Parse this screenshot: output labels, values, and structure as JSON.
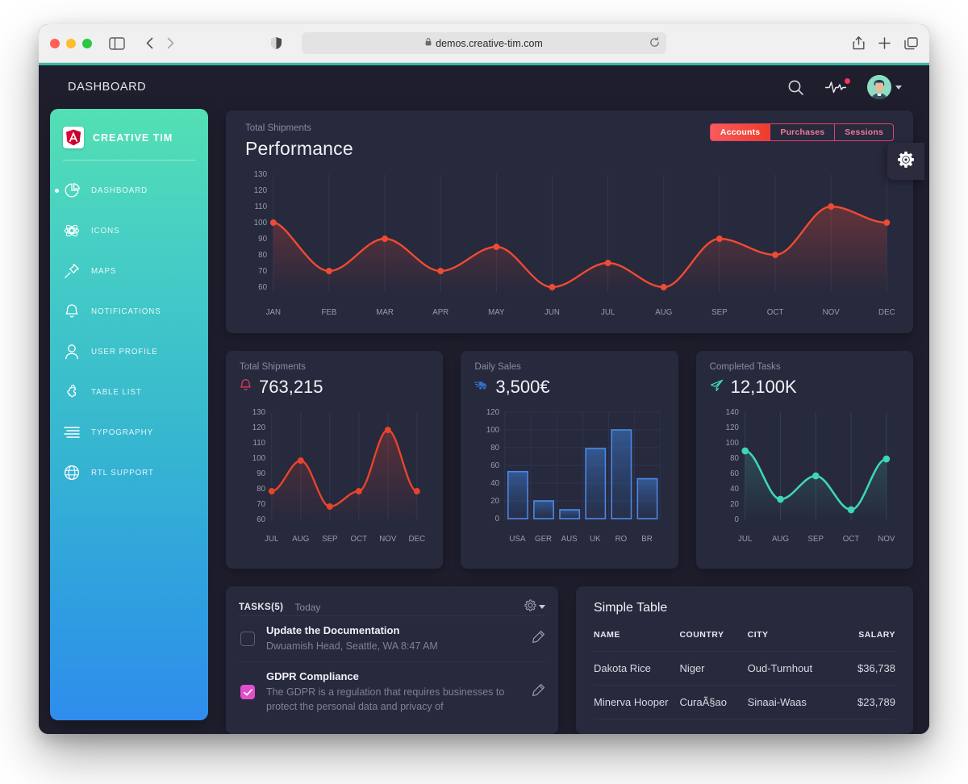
{
  "browser": {
    "url": "demos.creative-tim.com",
    "lock_icon": "lock-icon",
    "reload_icon": "reload-icon",
    "back_icon": "back-arrow-icon",
    "forward_icon": "forward-arrow-icon",
    "sidebar_icon": "sidebar-toggle-icon",
    "shield_icon": "shield-icon",
    "share_icon": "share-icon",
    "newtab_icon": "plus-icon",
    "tabs_icon": "tab-overview-icon"
  },
  "topbar": {
    "title": "DASHBOARD",
    "search_icon": "search-icon",
    "activity_icon": "activity-pulse-icon",
    "avatar": "user-avatar"
  },
  "sidebar": {
    "brand": "CREATIVE TIM",
    "brand_logo": "angular-logo-icon",
    "items": [
      {
        "label": "DASHBOARD",
        "icon": "pie-chart-icon",
        "active": true
      },
      {
        "label": "ICONS",
        "icon": "atom-icon",
        "active": false
      },
      {
        "label": "MAPS",
        "icon": "pin-icon",
        "active": false
      },
      {
        "label": "NOTIFICATIONS",
        "icon": "bell-icon",
        "active": false
      },
      {
        "label": "USER PROFILE",
        "icon": "user-icon",
        "active": false
      },
      {
        "label": "TABLE LIST",
        "icon": "puzzle-icon",
        "active": false
      },
      {
        "label": "TYPOGRAPHY",
        "icon": "text-align-icon",
        "active": false
      },
      {
        "label": "RTL SUPPORT",
        "icon": "globe-icon",
        "active": false
      }
    ]
  },
  "performance": {
    "subtitle": "Total Shipments",
    "title": "Performance",
    "tabs": [
      {
        "label": "Accounts",
        "active": true
      },
      {
        "label": "Purchases",
        "active": false
      },
      {
        "label": "Sessions",
        "active": false
      }
    ],
    "settings_icon": "gear-icon"
  },
  "cards": {
    "shipments": {
      "subtitle": "Total Shipments",
      "value": "763,215",
      "icon": "bell-icon",
      "color": "#f5365c"
    },
    "sales": {
      "subtitle": "Daily Sales",
      "value": "3,500€",
      "icon": "shipping-truck-icon",
      "color": "#2f74d0"
    },
    "tasks": {
      "subtitle": "Completed Tasks",
      "value": "12,100K",
      "icon": "send-plane-icon",
      "color": "#3ed6b5"
    }
  },
  "tasks_panel": {
    "title": "TASKS(5)",
    "today": "Today",
    "gear_icon": "gear-icon",
    "caret_icon": "chevron-down-icon",
    "edit_icon": "pencil-icon",
    "items": [
      {
        "title": "Update the Documentation",
        "desc": "Dwuamish Head, Seattle, WA 8:47 AM",
        "checked": false
      },
      {
        "title": "GDPR Compliance",
        "desc": "The GDPR is a regulation that requires businesses to protect the personal data and privacy of",
        "checked": true
      }
    ]
  },
  "simple_table": {
    "title": "Simple Table",
    "columns": [
      "NAME",
      "COUNTRY",
      "CITY",
      "SALARY"
    ],
    "rows": [
      {
        "name": "Dakota Rice",
        "country": "Niger",
        "city": "Oud-Turnhout",
        "salary": "$36,738"
      },
      {
        "name": "Minerva Hooper",
        "country": "CuraÃ§ao",
        "city": "Sinaai-Waas",
        "salary": "$23,789"
      }
    ]
  },
  "chart_data": [
    {
      "type": "line",
      "name": "performance-chart",
      "title": "Performance",
      "categories": [
        "JAN",
        "FEB",
        "MAR",
        "APR",
        "MAY",
        "JUN",
        "JUL",
        "AUG",
        "SEP",
        "OCT",
        "NOV",
        "DEC"
      ],
      "values": [
        100,
        70,
        90,
        70,
        85,
        60,
        75,
        60,
        90,
        80,
        110,
        100
      ],
      "yticks": [
        60,
        70,
        80,
        90,
        100,
        110,
        120,
        130
      ],
      "ylim": [
        55,
        133
      ],
      "xlabel": "",
      "ylabel": "",
      "grid": "vertical",
      "color": "#ef4b33",
      "legend": "none"
    },
    {
      "type": "line",
      "name": "total-shipments-chart",
      "title": "Total Shipments",
      "categories": [
        "JUL",
        "AUG",
        "SEP",
        "OCT",
        "NOV",
        "DEC"
      ],
      "values": [
        80,
        100,
        70,
        80,
        120,
        80
      ],
      "yticks": [
        60,
        70,
        80,
        90,
        100,
        110,
        120,
        130
      ],
      "ylim": [
        55,
        133
      ],
      "grid": "vertical",
      "color": "#e8442c",
      "legend": "none"
    },
    {
      "type": "bar",
      "name": "daily-sales-chart",
      "title": "Daily Sales",
      "categories": [
        "USA",
        "GER",
        "AUS",
        "UK",
        "RO",
        "BR"
      ],
      "values": [
        53,
        20,
        10,
        79,
        100,
        45
      ],
      "yticks": [
        0,
        20,
        40,
        60,
        80,
        100,
        120
      ],
      "ylim": [
        0,
        120
      ],
      "grid": "both",
      "color": "#2f74d0",
      "legend": "none"
    },
    {
      "type": "line",
      "name": "completed-tasks-chart",
      "title": "Completed Tasks",
      "categories": [
        "JUL",
        "AUG",
        "SEP",
        "OCT",
        "NOV"
      ],
      "values": [
        90,
        27,
        60,
        13,
        80
      ],
      "yticks": [
        0,
        20,
        40,
        60,
        80,
        100,
        120,
        140
      ],
      "ylim": [
        0,
        145
      ],
      "grid": "vertical",
      "color": "#3ed6b5",
      "legend": "none"
    }
  ]
}
